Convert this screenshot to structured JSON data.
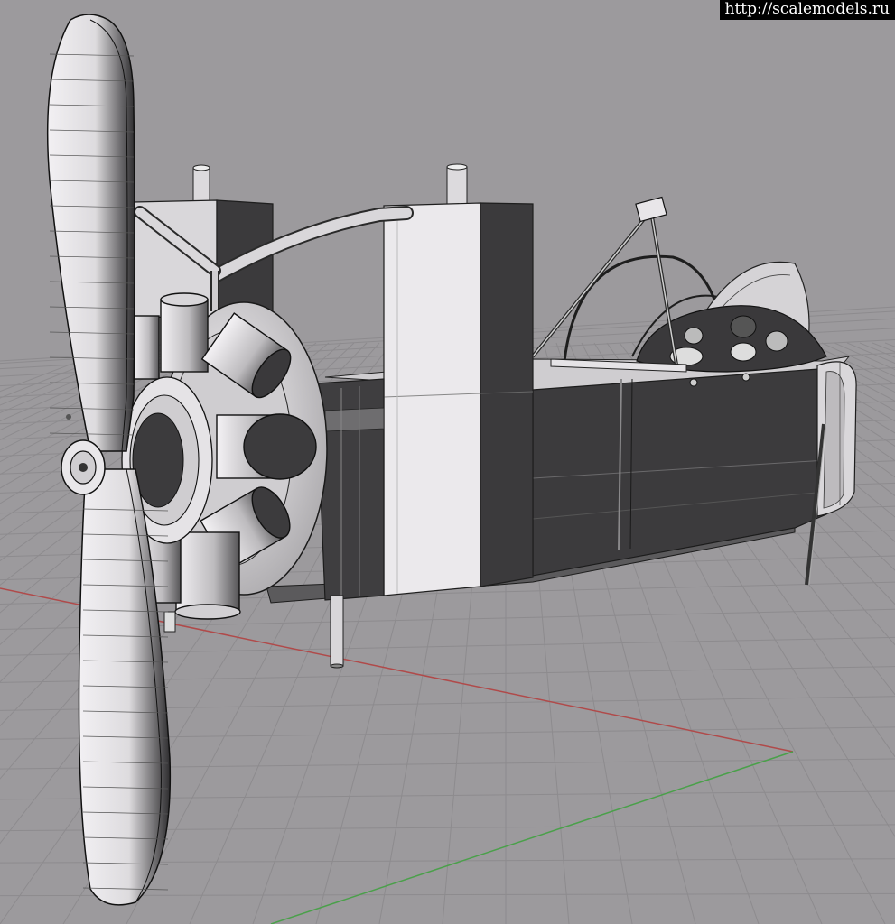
{
  "watermark": {
    "text": "http://scalemodels.ru"
  },
  "scene": {
    "subject": "3D wireframe-shaded model of an early aircraft fuselage with rotary engine and propeller",
    "background_color": "#9c9a9d",
    "grid_color": "#8e8c8f",
    "x_axis_color": "#b04a4a",
    "y_axis_color": "#4aa04a",
    "surface_light": "#e9e7ea",
    "surface_dark": "#3a393b"
  }
}
